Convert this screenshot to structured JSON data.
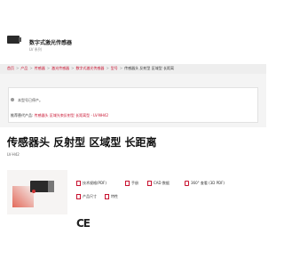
{
  "series": {
    "title": "数字式激光传感器",
    "subtitle": "LV 系列"
  },
  "breadcrumbs": [
    "首页",
    "产品",
    "传感器",
    "激光传感器",
    "数字式激光传感器",
    "型号"
  ],
  "breadcrumb_current": "传感器头 反射型 区域型 长距离",
  "notice": {
    "text": "本型号已停产。",
    "alt_label": "推荐替代产品:",
    "alt_link": "传感器头 区域光束反射型 长距离型 - LV-NH42"
  },
  "product": {
    "title": "传感器头 反射型 区域型 长距离",
    "model": "LV-H42"
  },
  "downloads": {
    "spec": "技术规格(PDF)",
    "manual": "手册",
    "cad": "CAD 数据",
    "view3d": "360° 查看 (3D PDF)",
    "dimensions": "产品尺寸",
    "features": "特性"
  },
  "certification": "CE",
  "accent_color": "#c8102e"
}
